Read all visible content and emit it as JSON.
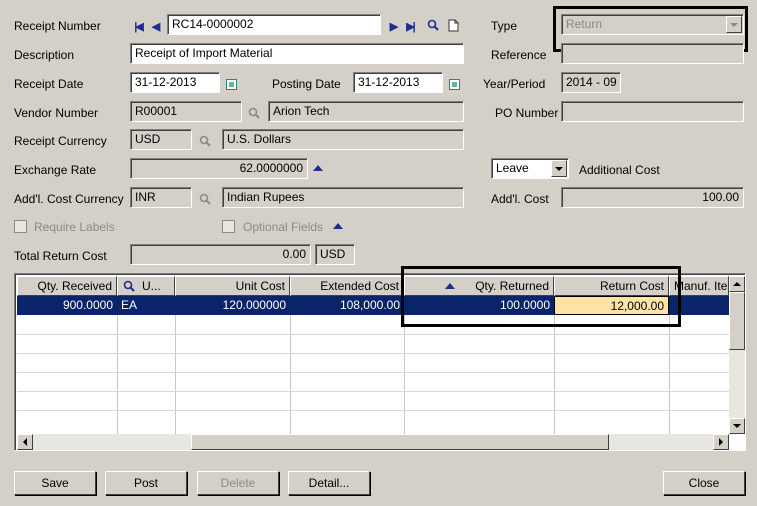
{
  "form": {
    "receipt_number_label": "Receipt Number",
    "receipt_number": "RC14-0000002",
    "description_label": "Description",
    "description": "Receipt of Import Material",
    "receipt_date_label": "Receipt Date",
    "receipt_date": "31-12-2013",
    "posting_date_label": "Posting Date",
    "posting_date": "31-12-2013",
    "vendor_number_label": "Vendor Number",
    "vendor_number": "R00001",
    "vendor_name": "Arion Tech",
    "receipt_currency_label": "Receipt Currency",
    "receipt_currency": "USD",
    "receipt_currency_name": "U.S. Dollars",
    "exchange_rate_label": "Exchange Rate",
    "exchange_rate": "62.0000000",
    "addl_cost_currency_label": "Add'l. Cost Currency",
    "addl_cost_currency": "INR",
    "addl_cost_currency_name": "Indian Rupees",
    "require_labels_label": "Require Labels",
    "optional_fields_label": "Optional Fields",
    "total_return_cost_label": "Total Return Cost",
    "total_return_cost": "0.00",
    "total_return_cost_currency": "USD",
    "type_label": "Type",
    "type_value": "Return",
    "reference_label": "Reference",
    "reference": "",
    "year_period_label": "Year/Period",
    "year_period": "2014 - 09",
    "po_number_label": "PO Number",
    "po_number": "",
    "addl_cost_mode": "Leave",
    "additional_cost_label": "Additional Cost",
    "addl_cost_label": "Add'l. Cost",
    "addl_cost": "100.00"
  },
  "grid": {
    "headers": {
      "qty_received": "Qty. Received",
      "uom": "U...",
      "unit_cost": "Unit Cost",
      "extended_cost": "Extended Cost",
      "qty_returned": "Qty. Returned",
      "return_cost": "Return Cost",
      "manuf_item": "Manuf. Ite"
    },
    "rows": [
      {
        "qty_received": "900.0000",
        "uom": "EA",
        "unit_cost": "120.000000",
        "extended_cost": "108,000.00",
        "qty_returned": "100.0000",
        "return_cost": "12,000.00",
        "manuf_item": ""
      }
    ]
  },
  "buttons": {
    "save": "Save",
    "post": "Post",
    "delete": "Delete",
    "detail": "Detail...",
    "close": "Close"
  },
  "colors": {
    "window_bg": "#d4d0c8",
    "selected_row": "#0a246a",
    "edit_cell": "#ffe3a6",
    "nav_icon": "#1c2d8f"
  }
}
